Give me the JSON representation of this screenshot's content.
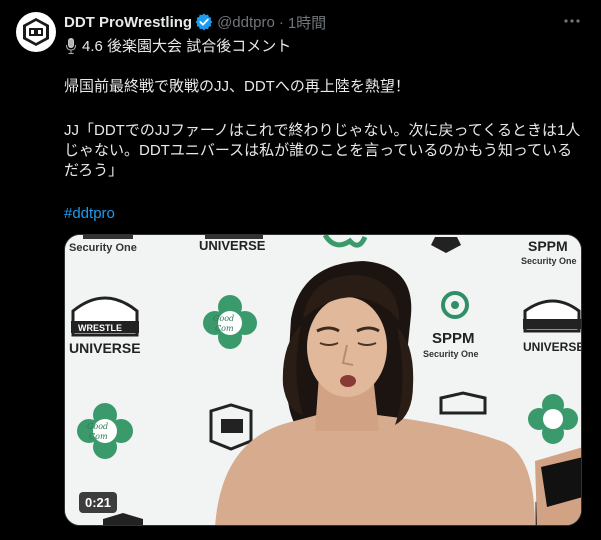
{
  "account": {
    "display_name": "DDT ProWrestling",
    "handle": "@ddtpro",
    "separator": "·",
    "time": "1時間",
    "verified_color": "#1d9bf0"
  },
  "tweet": {
    "subtitle": "4.6 後楽園大会 試合後コメント",
    "paragraph1": "帰国前最終戦で敗戦のJJ、DDTへの再上陸を熱望！",
    "paragraph2": "JJ「DDTでのJJファーノはこれで終わりじゃない。次に戻ってくるときは1人じゃない。DDTユニバースは私が誰のことを言っているのかもう知っているだろう」",
    "hashtag": "#ddtpro"
  },
  "media": {
    "duration": "0:21",
    "backdrop_logos": {
      "universe": "UNIVERSE",
      "wrestle": "WRESTLE",
      "sppm": "SPPM",
      "security_one": "Security One",
      "good_com": "Good Com Asset"
    }
  },
  "icons": {
    "avatar": "ddt-logo-icon",
    "verified": "verified-badge-icon",
    "more": "more-icon",
    "mic": "microphone-icon"
  }
}
